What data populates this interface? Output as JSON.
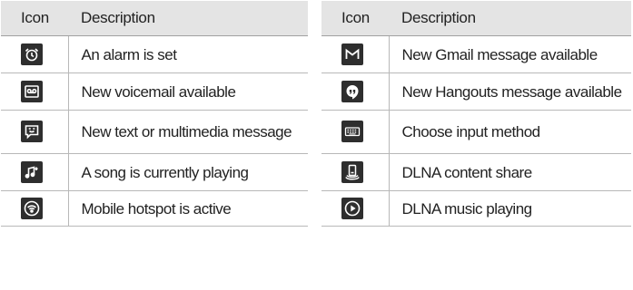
{
  "headers": {
    "icon": "Icon",
    "description": "Description"
  },
  "left_rows": [
    {
      "icon": "alarm-clock-icon",
      "label": "An alarm is set"
    },
    {
      "icon": "voicemail-icon",
      "label": "New voicemail available"
    },
    {
      "icon": "message-icon",
      "label": "New text or multimedia message"
    },
    {
      "icon": "music-note-icon",
      "label": "A song is currently playing"
    },
    {
      "icon": "wifi-hotspot-icon",
      "label": "Mobile hotspot is active"
    }
  ],
  "right_rows": [
    {
      "icon": "gmail-icon",
      "label": "New Gmail message available"
    },
    {
      "icon": "hangouts-icon",
      "label": "New Hangouts message available"
    },
    {
      "icon": "keyboard-icon",
      "label": "Choose input method"
    },
    {
      "icon": "dlna-share-icon",
      "label": "DLNA content share"
    },
    {
      "icon": "play-icon",
      "label": "DLNA music playing"
    }
  ],
  "colors": {
    "header_bg": "#e4e4e4",
    "icon_bg": "#2e2e2e",
    "icon_fg": "#ffffff",
    "rule": "#b8b8b8"
  }
}
